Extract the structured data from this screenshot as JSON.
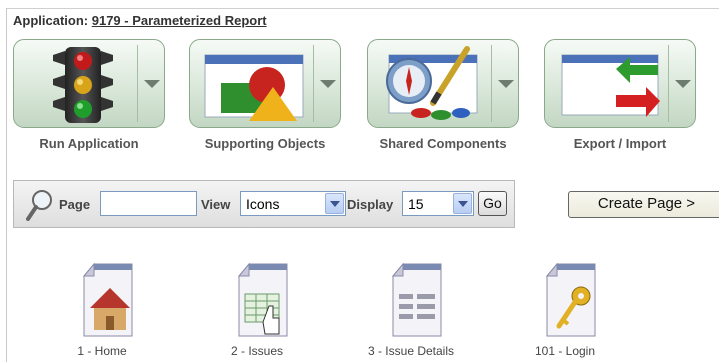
{
  "application": {
    "prefix": "Application:",
    "link": "9179 - Parameterized Report"
  },
  "big_buttons": [
    {
      "label": "Run Application",
      "icon": "traffic-light-icon"
    },
    {
      "label": "Supporting Objects",
      "icon": "shapes-icon"
    },
    {
      "label": "Shared Components",
      "icon": "compass-brush-icon"
    },
    {
      "label": "Export / Import",
      "icon": "export-import-arrows-icon"
    }
  ],
  "search": {
    "page_label": "Page",
    "page_value": "",
    "view_label": "View",
    "view_value": "Icons",
    "display_label": "Display",
    "display_value": "15",
    "go_label": "Go"
  },
  "create_button": "Create Page >",
  "pages": [
    {
      "label": "1 - Home",
      "icon": "home-page-icon"
    },
    {
      "label": "2 - Issues",
      "icon": "report-page-icon"
    },
    {
      "label": "3 - Issue Details",
      "icon": "form-page-icon"
    },
    {
      "label": "101 - Login",
      "icon": "login-key-icon"
    }
  ]
}
